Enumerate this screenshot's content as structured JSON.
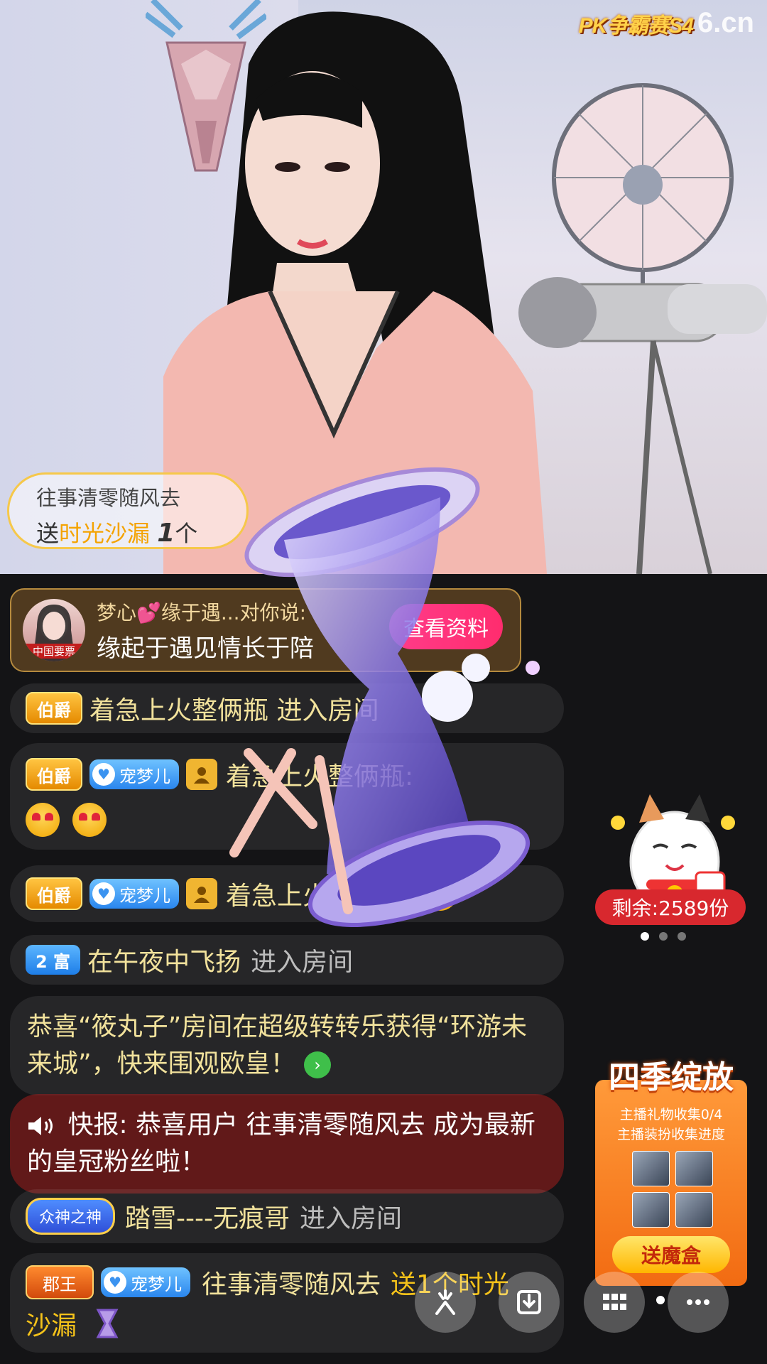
{
  "logo": {
    "badge": "PK争霸赛S4",
    "site": "6.cn"
  },
  "gift_banner": {
    "user": "往事清零随风去",
    "send_prefix": "送",
    "gift": "时光沙漏",
    "count": "1",
    "unit": "个"
  },
  "profile_card": {
    "avatar_tag": "中国要票",
    "name": "梦心💕缘于遇...对你说:",
    "message": "缘起于遇见情长于陪",
    "button": "查看资料"
  },
  "chat": [
    {
      "level": "伯爵",
      "text": "着急上火整俩瓶 进入房间"
    },
    {
      "level": "伯爵",
      "fan": "宠梦儿",
      "text": "着急上火整俩瓶:"
    },
    {
      "level": "伯爵",
      "fan": "宠梦儿",
      "text": "着急上火整俩瓶:"
    },
    {
      "rich": "2 富",
      "name": "在午夜中飞扬",
      "action": "进入房间"
    },
    {
      "system": "恭喜“筱丸子”房间在超级转转乐获得“环游未来城”，快来围观欧皇！"
    },
    {
      "news": "快报: 恭喜用户 往事清零随风去 成为最新的皇冠粉丝啦！"
    },
    {
      "badge": "众神之神",
      "name": "踏雪----无痕哥",
      "action": "进入房间"
    },
    {
      "level": "郡王",
      "fan": "宠梦儿",
      "name": "往事清零随风去",
      "send": "送1个时光",
      "gift": "沙漏"
    }
  ],
  "lucky_cat": {
    "remaining": "剩余:2589份"
  },
  "season": {
    "title": "四季绽放",
    "line1": "主播礼物收集0/4",
    "line2": "主播装扮收集进度",
    "button": "送魔盒"
  },
  "toolbar": {
    "icons": [
      "share-icon",
      "download-icon",
      "grid-icon",
      "more-icon"
    ]
  },
  "colors": {
    "accent_gold": "#f4c21a",
    "accent_pink": "#ff2c6e",
    "news_red": "#a01e1e"
  }
}
